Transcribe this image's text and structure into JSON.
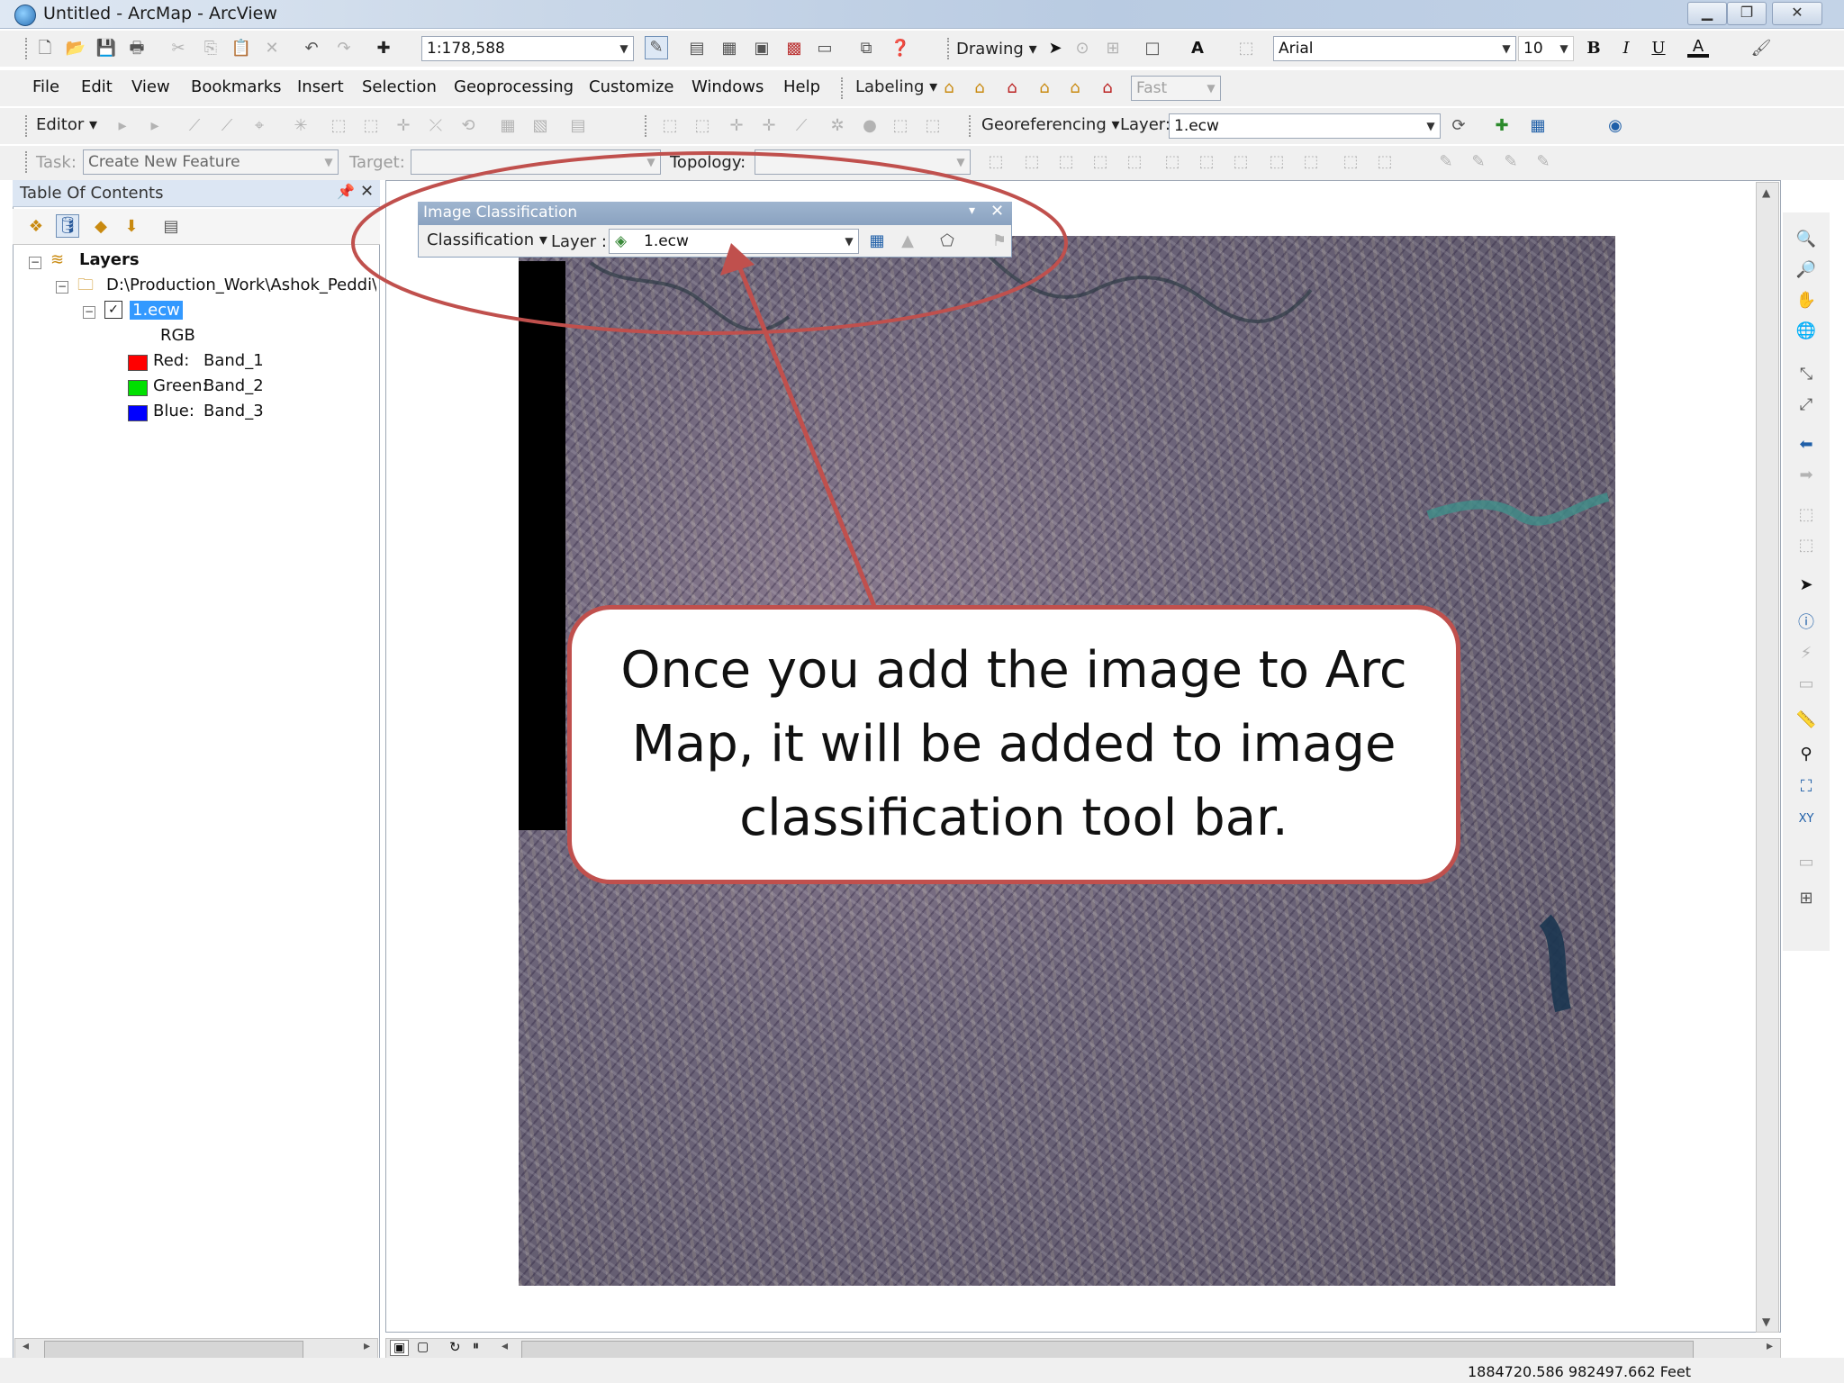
{
  "window": {
    "title": "Untitled - ArcMap - ArcView"
  },
  "standard_toolbar": {
    "scale": "1:178,588",
    "drawing_label": "Drawing",
    "font_name": "Arial",
    "font_size": "10",
    "bold": "B",
    "italic": "I",
    "underline": "U",
    "text_color": "A"
  },
  "menu": {
    "items": [
      "File",
      "Edit",
      "View",
      "Bookmarks",
      "Insert",
      "Selection",
      "Geoprocessing",
      "Customize",
      "Windows",
      "Help"
    ],
    "labeling": "Labeling",
    "labeling_mode": "Fast"
  },
  "editor_toolbar": {
    "editor": "Editor",
    "georeferencing": "Georeferencing",
    "layer_label": "Layer:",
    "layer_value": "1.ecw"
  },
  "task_toolbar": {
    "task_label": "Task:",
    "task_value": "Create New Feature",
    "target_label": "Target:",
    "topology_label": "Topology:"
  },
  "toc": {
    "title": "Table Of Contents",
    "layers_label": "Layers",
    "folder": "D:\\Production_Work\\Ashok_Peddi\\",
    "layer_name": "1.ecw",
    "rgb": "RGB",
    "bands": [
      {
        "channel": "Red:",
        "band": "Band_1",
        "color": "#ff0000"
      },
      {
        "channel": "Green:",
        "band": "Band_2",
        "color": "#00e000"
      },
      {
        "channel": "Blue:",
        "band": "Band_3",
        "color": "#0000ff"
      }
    ]
  },
  "image_classification": {
    "title": "Image Classification",
    "classification": "Classification",
    "layer_label": "Layer :",
    "layer_value": "1.ecw"
  },
  "callout": {
    "text": "Once you add the image to Arc Map, it will be added to image classification tool bar.",
    "color": "#c0504d"
  },
  "status": {
    "coords": "1884720.586  982497.662 Feet"
  }
}
